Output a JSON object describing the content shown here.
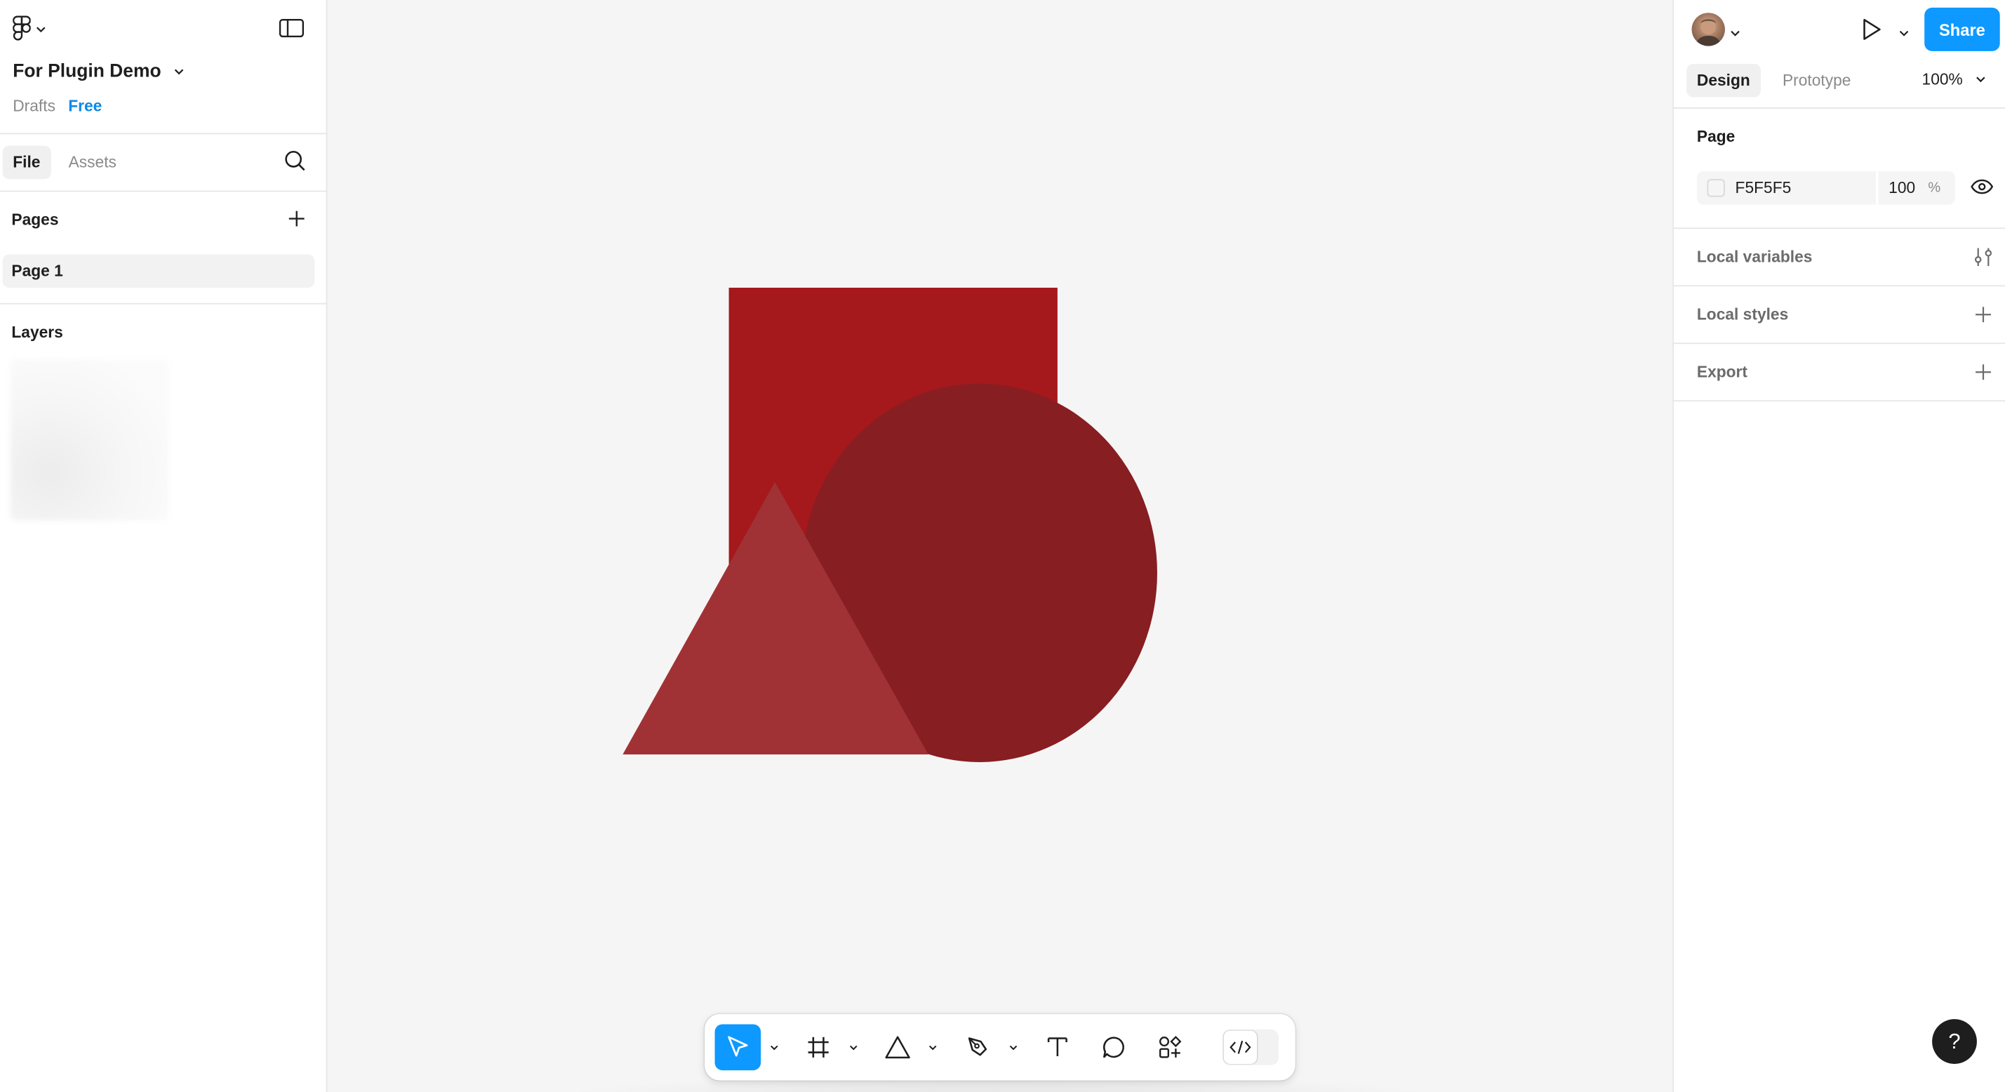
{
  "file": {
    "title": "For Plugin Demo",
    "location": "Drafts",
    "plan": "Free"
  },
  "left_panel": {
    "tabs": [
      "File",
      "Assets"
    ],
    "pages_title": "Pages",
    "pages": [
      "Page 1"
    ],
    "layers_title": "Layers"
  },
  "canvas": {
    "background": "#F5F5F5",
    "shapes": [
      {
        "type": "rectangle",
        "color": "#A5181C"
      },
      {
        "type": "ellipse",
        "color": "#871E22"
      },
      {
        "type": "triangle",
        "color": "#A03236"
      }
    ]
  },
  "toolbar": {
    "tools": [
      "move",
      "frame",
      "shape",
      "pen",
      "text",
      "comment",
      "actions",
      "dev-mode"
    ],
    "selected": "move"
  },
  "right_panel": {
    "share_label": "Share",
    "tabs": [
      "Design",
      "Prototype"
    ],
    "zoom": "100%",
    "page_section_title": "Page",
    "page_color": "F5F5F5",
    "page_opacity": "100",
    "percent_symbol": "%",
    "rows": [
      "Local variables",
      "Local styles",
      "Export"
    ]
  },
  "help_label": "?"
}
